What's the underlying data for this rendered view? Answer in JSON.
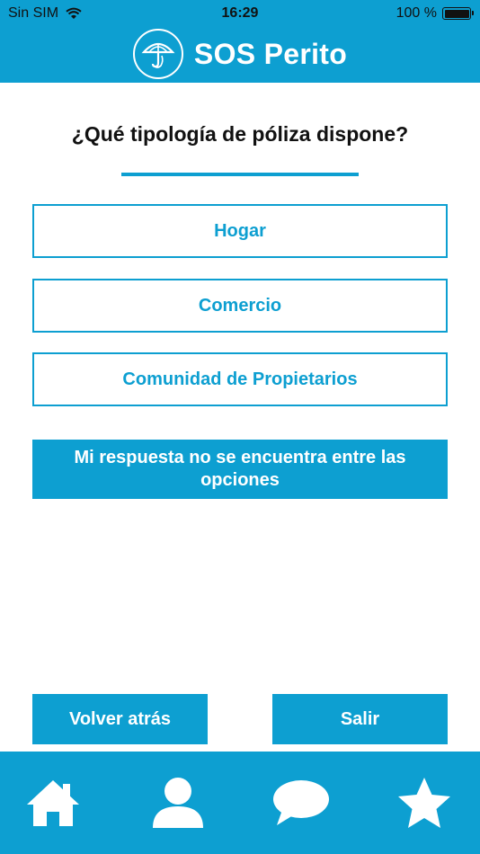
{
  "status_bar": {
    "carrier": "Sin SIM",
    "time": "16:29",
    "battery": "100 %",
    "icons": [
      "wifi-icon",
      "battery-icon"
    ]
  },
  "header": {
    "brand_name": "SOS Perito",
    "logo_icon": "umbrella-logo-icon"
  },
  "question": {
    "title": "¿Qué tipología de póliza dispone?"
  },
  "options": [
    {
      "label": "Hogar"
    },
    {
      "label": "Comercio"
    },
    {
      "label": "Comunidad de Propietarios"
    }
  ],
  "no_answer": {
    "label": "Mi respuesta no se encuentra entre las opciones"
  },
  "footer_buttons": {
    "back_label": "Volver atrás",
    "exit_label": "Salir"
  },
  "tabbar": {
    "items": [
      {
        "icon": "home-icon"
      },
      {
        "icon": "user-icon"
      },
      {
        "icon": "chat-icon"
      },
      {
        "icon": "star-icon"
      }
    ]
  },
  "colors": {
    "accent": "#0d9fd1",
    "background": "#ffffff",
    "text": "#111111"
  }
}
